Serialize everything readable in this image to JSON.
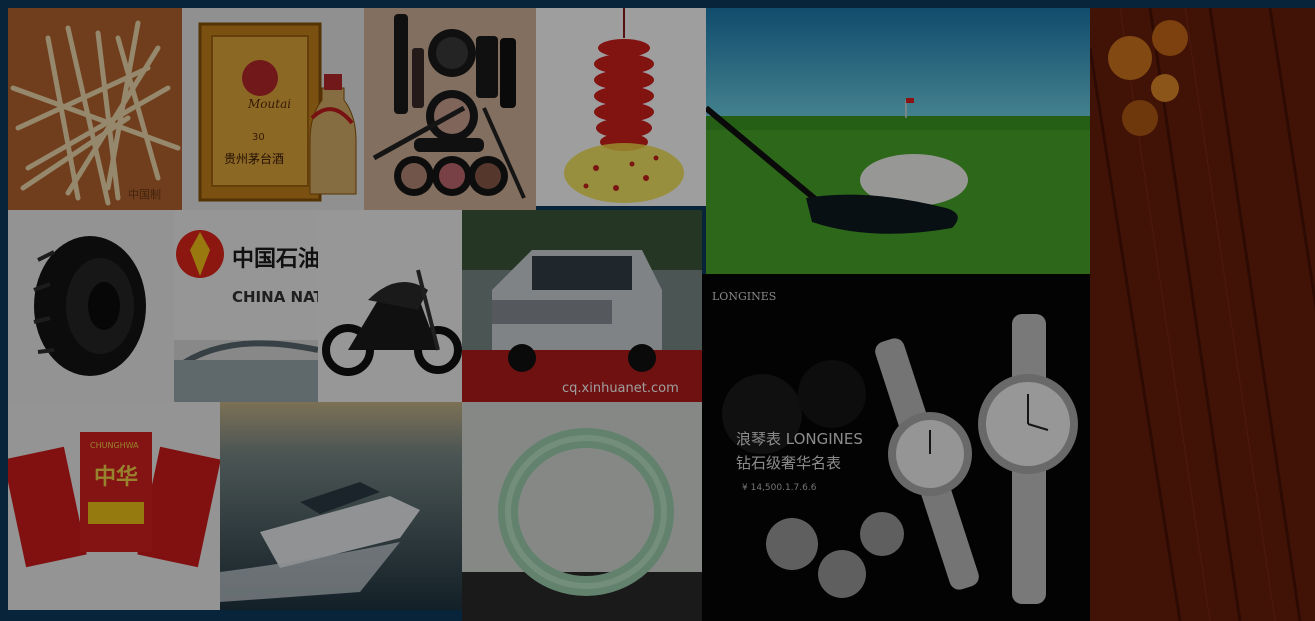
{
  "collage": {
    "tiles": [
      {
        "name": "chopsticks-photo",
        "label": "中国制"
      },
      {
        "name": "moutai-liquor-photo",
        "brand": "Moutai",
        "age_mark": "30",
        "cn_text": "贵州茅台酒"
      },
      {
        "name": "cosmetics-photo"
      },
      {
        "name": "firecrackers-photo"
      },
      {
        "name": "golf-photo"
      },
      {
        "name": "wood-floor-photo"
      },
      {
        "name": "tire-photo"
      },
      {
        "name": "china-national-sign-photo",
        "cn_text": "中国石油",
        "en_text": "CHINA NATION"
      },
      {
        "name": "motorcycle-photo"
      },
      {
        "name": "land-rover-photo",
        "watermark": "cq.xinhuanet.com"
      },
      {
        "name": "longines-watch-ad-photo",
        "logo": "LONGINES",
        "headline": "浪琴表 LONGINES",
        "subline": "钻石级奢华名表",
        "price": "¥ 14,500.1.7.6.6"
      },
      {
        "name": "zhonghua-cigarettes-photo",
        "brand": "CHUNGHWA",
        "cn_text": "中华"
      },
      {
        "name": "yacht-photo"
      },
      {
        "name": "jade-bangle-photo"
      }
    ]
  }
}
